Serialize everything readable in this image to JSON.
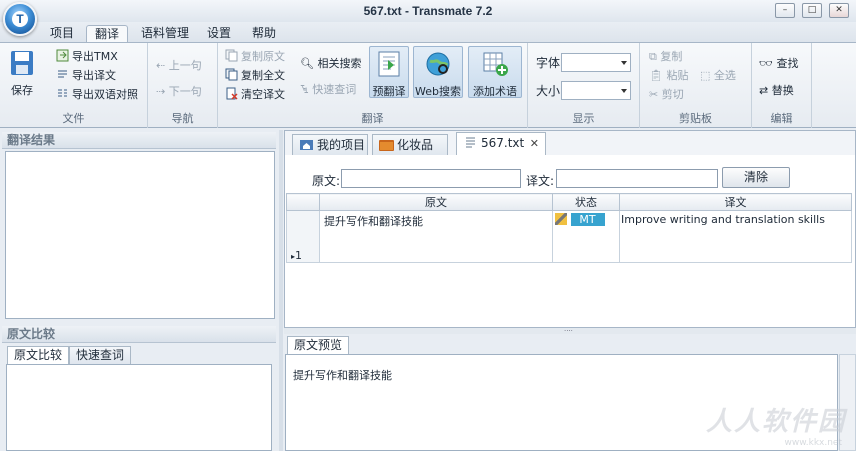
{
  "window": {
    "title": "567.txt - Transmate 7.2",
    "minimize": "–",
    "maximize": "□",
    "close": "✕"
  },
  "menu": {
    "tabs": [
      "项目",
      "翻译",
      "语料管理",
      "设置",
      "帮助"
    ],
    "active": "翻译"
  },
  "ribbon": {
    "file": {
      "label": "文件",
      "save": "保存",
      "export_tmx": "导出TMX",
      "export_translation": "导出译文",
      "export_bilingual": "导出双语对照"
    },
    "nav": {
      "label": "导航",
      "prev": "上一句",
      "next": "下一句"
    },
    "translate": {
      "label": "翻译",
      "copy_source": "复制原文",
      "copy_all": "复制全文",
      "clear_translation": "清空译文",
      "related_search": "相关搜索",
      "quick_lookup": "快速查词",
      "pretranslate": "预翻译",
      "web_search": "Web搜索",
      "add_term": "添加术语"
    },
    "display": {
      "label": "显示",
      "font": "字体",
      "size": "大小"
    },
    "clipboard": {
      "label": "剪贴板",
      "copy": "复制",
      "paste": "粘贴",
      "select_all": "全选",
      "cut": "剪切"
    },
    "edit": {
      "label": "编辑",
      "find": "查找",
      "replace": "替换"
    }
  },
  "left": {
    "results_title": "翻译结果",
    "compare_title": "原文比较",
    "tab_compare": "原文比较",
    "tab_lookup": "快速查词"
  },
  "doctabs": {
    "project": "我的项目",
    "cosmetics": "化妆品",
    "file": "567.txt"
  },
  "filter": {
    "source_label": "原文:",
    "target_label": "译文:",
    "clear": "清除"
  },
  "grid": {
    "headers": [
      "原文",
      "状态",
      "译文"
    ],
    "rows": [
      {
        "num": "1",
        "source": "提升写作和翻译技能",
        "status": "MT",
        "target": "Improve writing and translation skills"
      }
    ]
  },
  "preview": {
    "tab": "原文预览",
    "text": "提升写作和翻译技能"
  },
  "watermark": {
    "text": "人人软件园",
    "url": "www.kkx.net"
  }
}
